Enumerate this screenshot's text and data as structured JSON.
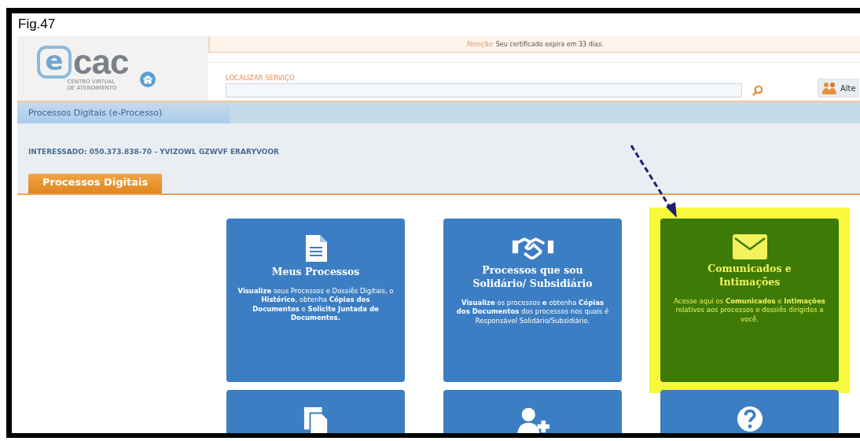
{
  "caption": "Fig.47",
  "logo": {
    "mark": "e",
    "name": "cac",
    "tagline": [
      "CENTRO VIRTUAL",
      "DE ATENDIMENTO"
    ]
  },
  "alert": {
    "label": "Atenção:",
    "message": "Seu certificado expira em 33 dias."
  },
  "search": {
    "label": "LOCALIZAR SERVIÇO"
  },
  "profile_button": {
    "label": "Alte"
  },
  "breadcrumb": "Processos Digitais (e-Processo)",
  "interessado": "INTERESSADO: 050.373.838-70 - YVIZOWL GZWVF ERARYVOOR",
  "section_tab": "Processos Digitais",
  "cards": [
    {
      "title": "Meus Processos",
      "description": "**Visualize** seus Processos e Dossiês Digitais, o **Histórico**, obtenha **Cópias dos Documentos** e **Solicite Juntada de Documentos.**",
      "highlighted": false
    },
    {
      "title": "Processos que sou Solidário/ Subsidiário",
      "description": "**Visualize** os processos **e** obtenha **Cópias dos Documentos** dos processos nos quais é Responsável Solidário/Subsidiário.",
      "highlighted": false
    },
    {
      "title": "Comunicados e Intimações",
      "description": "Acesse aqui os **Comunicados** e **Intimações** relativos aos processos e dossiês dirigidos a você.",
      "highlighted": true
    },
    {
      "highlighted": false
    },
    {
      "highlighted": false
    },
    {
      "highlighted": false
    }
  ]
}
